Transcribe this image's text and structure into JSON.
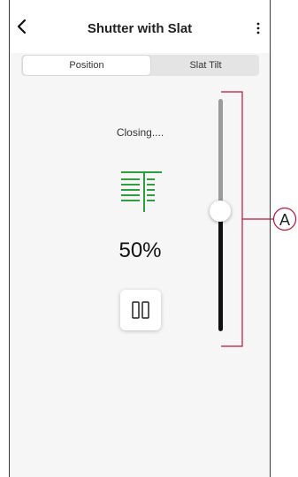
{
  "header": {
    "title": "Shutter with Slat",
    "back_icon": "chevron-left-icon",
    "more_icon": "kebab-menu-icon"
  },
  "tabs": [
    {
      "label": "Position",
      "active": true
    },
    {
      "label": "Slat Tilt",
      "active": false
    }
  ],
  "main": {
    "status": "Closing....",
    "shutter_icon": "shutter-icon",
    "percent_label": "50%",
    "pause_icon": "pause-icon"
  },
  "slider": {
    "level_percent": 50
  },
  "callout": {
    "label": "A",
    "color": "#c0143c"
  },
  "colors": {
    "accent_green": "#2e9e3e",
    "track_filled": "#111111",
    "track_empty": "#9c9c9c"
  }
}
